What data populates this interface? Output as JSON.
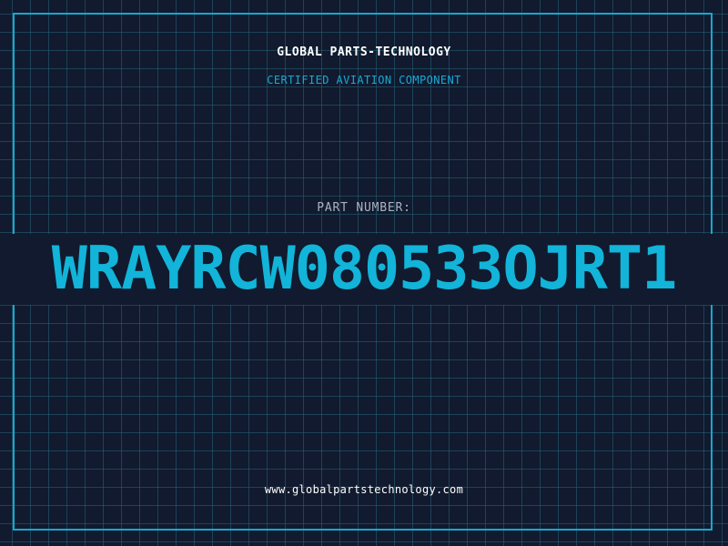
{
  "header": {
    "company": "GLOBAL PARTS-TECHNOLOGY",
    "subtitle": "CERTIFIED AVIATION COMPONENT"
  },
  "part": {
    "label": "PART NUMBER:",
    "number": "WRAYRCW080533OJRT1"
  },
  "footer": {
    "website": "www.globalpartstechnology.com"
  },
  "colors": {
    "background": "#111a2e",
    "grid": "#26627a",
    "accent": "#13a9cf",
    "label": "#aab4c3",
    "text": "#ffffff"
  }
}
